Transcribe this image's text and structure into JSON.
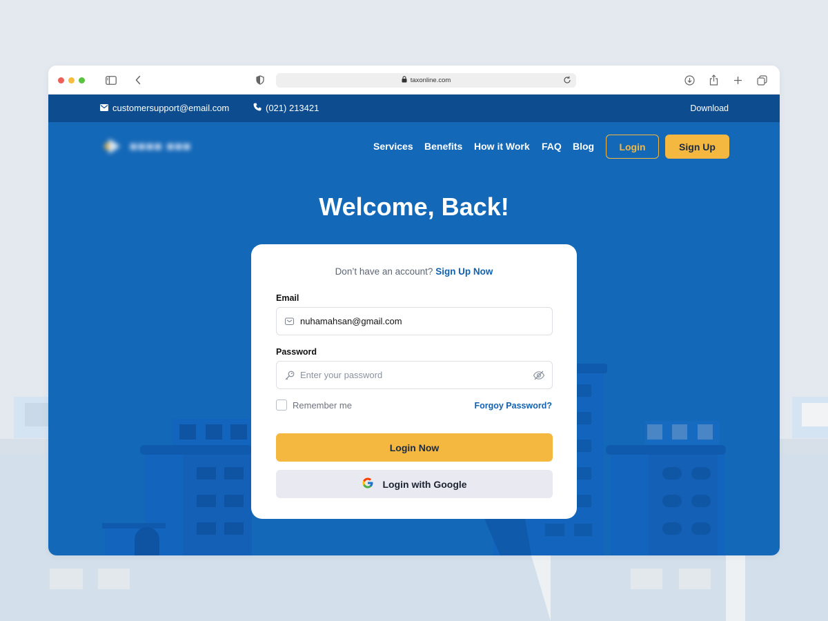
{
  "browser": {
    "url": "taxonline.com"
  },
  "topbar": {
    "email": "customersupport@email.com",
    "phone": "(021) 213421",
    "download": "Download"
  },
  "nav": {
    "items": [
      "Services",
      "Benefits",
      "How it Work",
      "FAQ",
      "Blog"
    ],
    "login": "Login",
    "signup": "Sign Up"
  },
  "page": {
    "heading": "Welcome, Back!"
  },
  "form": {
    "signup_prompt": "Don’t have an account?",
    "signup_link": "Sign Up Now",
    "email_label": "Email",
    "email_value": "nuhamahsan@gmail.com",
    "password_label": "Password",
    "password_placeholder": "Enter your password",
    "remember_label": "Remember me",
    "forgot_link": "Forgoy Password?",
    "submit": "Login Now",
    "google": "Login with Google"
  },
  "colors": {
    "primary_blue": "#1468b8",
    "topbar_blue": "#0d4d8f",
    "accent_yellow": "#f4b840",
    "link_blue": "#1261b0"
  },
  "icons": [
    "sidebar-icon",
    "chevron-left-icon",
    "shield-icon",
    "lock-icon",
    "reload-icon",
    "download-icon",
    "share-icon",
    "plus-icon",
    "tabs-icon",
    "mail-icon",
    "phone-icon",
    "key-icon",
    "eye-off-icon",
    "google-icon"
  ]
}
